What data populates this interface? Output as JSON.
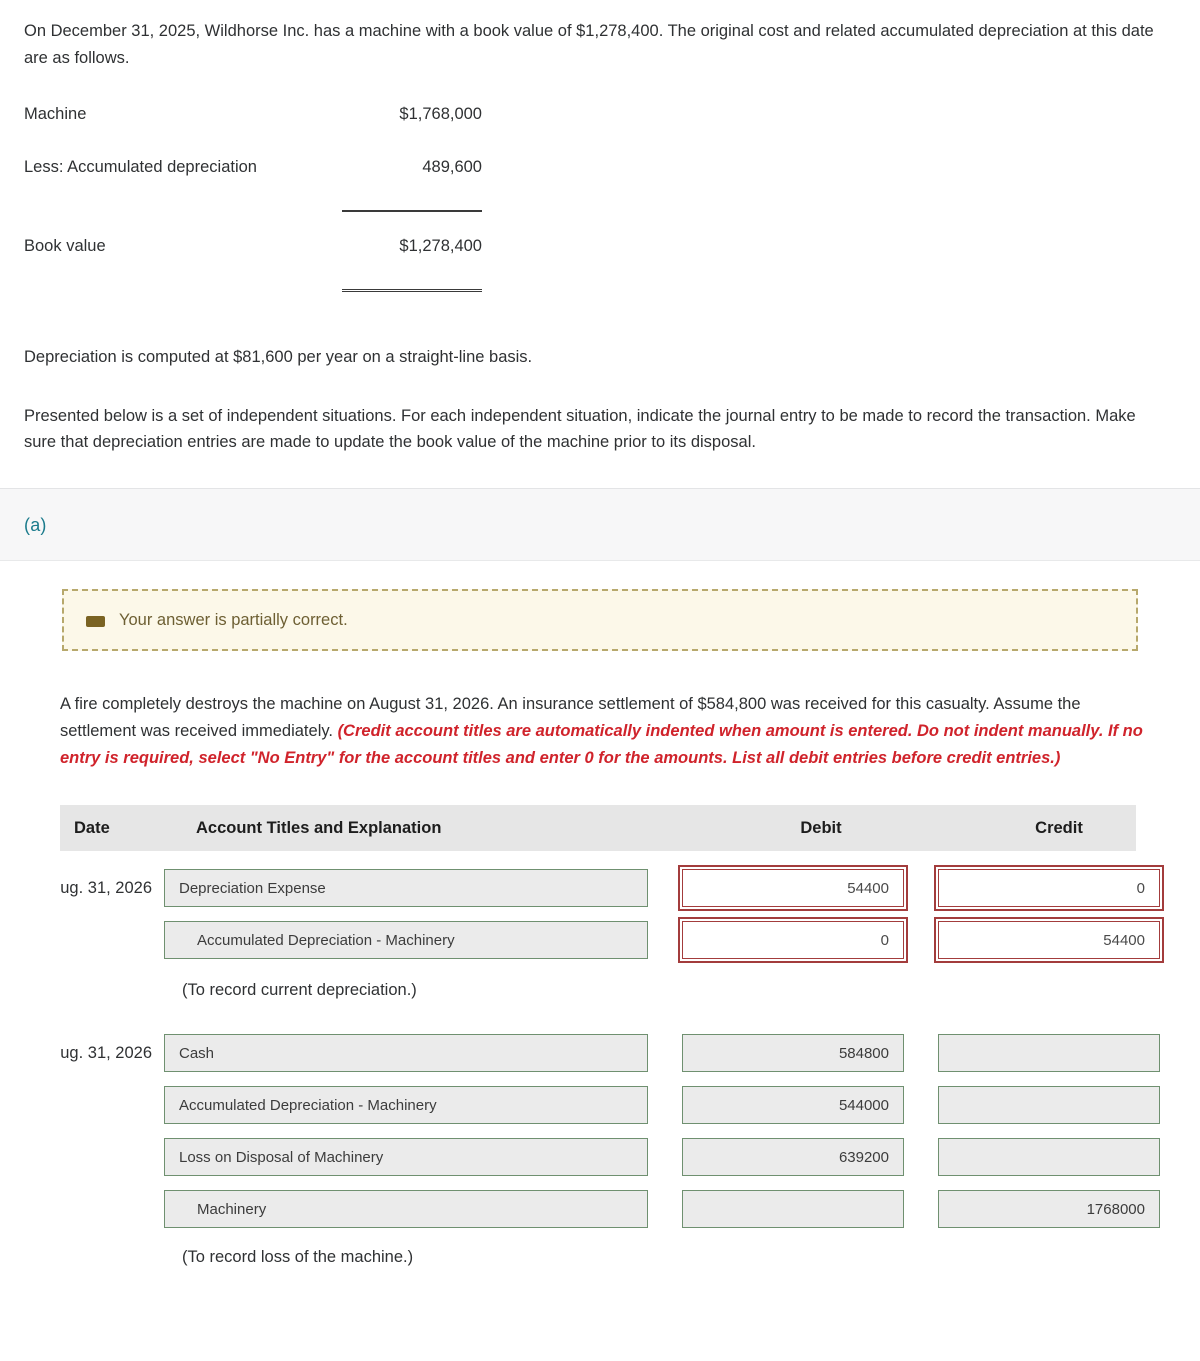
{
  "problem": {
    "intro": "On December 31, 2025, Wildhorse Inc. has a machine with a book value of $1,278,400. The original cost and related accumulated depreciation at this date are as follows.",
    "book_value_table": {
      "rows": [
        {
          "label": "Machine",
          "amount": "$1,768,000",
          "rule": "none"
        },
        {
          "label": "Less: Accumulated depreciation",
          "amount": "489,600",
          "rule": "single"
        },
        {
          "label": "Book value",
          "amount": "$1,278,400",
          "rule": "double"
        }
      ]
    },
    "depreciation_note": "Depreciation is computed at $81,600 per year on a straight-line basis.",
    "instructions": "Presented below is a set of independent situations. For each independent situation, indicate the journal entry to be made to record the transaction. Make sure that depreciation entries are made to update the book value of the machine prior to its disposal."
  },
  "part": {
    "letter": "(a)"
  },
  "alert": {
    "icon": "minus-square-icon",
    "message": "Your answer is partially correct."
  },
  "scenario": {
    "text_plain": "A fire completely destroys the machine on August 31, 2026. An insurance settlement of $584,800 was received for this casualty. Assume the settlement was received immediately. ",
    "text_red": "(Credit account titles are automatically indented when amount is entered. Do not indent manually. If no entry is required, select \"No Entry\" for the account titles and enter 0 for the amounts. List all debit entries before credit entries.)"
  },
  "journal": {
    "headers": {
      "date": "Date",
      "account": "Account Titles and Explanation",
      "debit": "Debit",
      "credit": "Credit"
    },
    "entries": [
      {
        "date": "ug. 31, 2026",
        "account": "Depreciation Expense",
        "indented": false,
        "debit": "54400",
        "credit": "0",
        "account_status": "correct",
        "debit_status": "flagged",
        "credit_status": "flagged"
      },
      {
        "date": "",
        "account": "Accumulated Depreciation - Machinery",
        "indented": true,
        "debit": "0",
        "credit": "54400",
        "account_status": "correct",
        "debit_status": "flagged",
        "credit_status": "flagged"
      }
    ],
    "memo_1": "(To record current depreciation.)",
    "entries_2": [
      {
        "date": "ug. 31, 2026",
        "account": "Cash",
        "indented": false,
        "debit": "584800",
        "credit": "",
        "account_status": "correct",
        "debit_status": "correct",
        "credit_status": "correct"
      },
      {
        "date": "",
        "account": "Accumulated Depreciation - Machinery",
        "indented": false,
        "debit": "544000",
        "credit": "",
        "account_status": "correct",
        "debit_status": "correct",
        "credit_status": "correct"
      },
      {
        "date": "",
        "account": "Loss on Disposal of Machinery",
        "indented": false,
        "debit": "639200",
        "credit": "",
        "account_status": "correct",
        "debit_status": "correct",
        "credit_status": "correct"
      },
      {
        "date": "",
        "account": "Machinery",
        "indented": true,
        "debit": "",
        "credit": "1768000",
        "account_status": "correct",
        "debit_status": "correct",
        "credit_status": "correct"
      }
    ],
    "memo_2": "(To record loss of the machine.)"
  },
  "colors": {
    "accent_teal": "#1b7b8c",
    "alert_bg": "#fcf8e9",
    "alert_border": "#b7a86c",
    "alert_text": "#6d5f33",
    "red_note": "#d0232b",
    "field_ok_border": "#6f9070",
    "field_flag_border": "#a33c3c",
    "header_bg": "#e6e6e6"
  }
}
